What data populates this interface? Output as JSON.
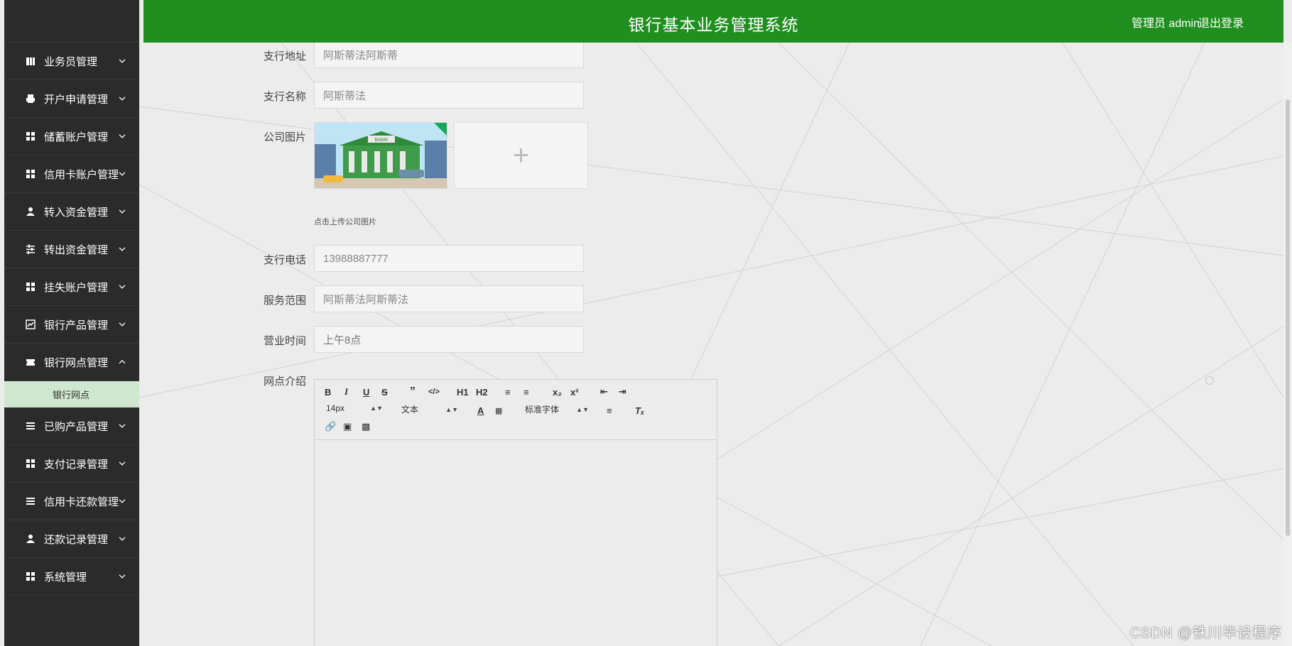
{
  "header": {
    "title": "银行基本业务管理系统",
    "user_text": "管理员 admin",
    "logout_label": "退出登录"
  },
  "sidebar": {
    "items": [
      {
        "label": "业务员管理",
        "icon": "book-icon"
      },
      {
        "label": "开户申请管理",
        "icon": "print-icon"
      },
      {
        "label": "储蓄账户管理",
        "icon": "grid-icon"
      },
      {
        "label": "信用卡账户管理",
        "icon": "grid-icon"
      },
      {
        "label": "转入资金管理",
        "icon": "user-icon"
      },
      {
        "label": "转出资金管理",
        "icon": "sliders-icon"
      },
      {
        "label": "挂失账户管理",
        "icon": "grid-icon"
      },
      {
        "label": "银行产品管理",
        "icon": "chart-icon"
      },
      {
        "label": "银行网点管理",
        "icon": "ticket-icon",
        "expanded": true,
        "sub": "银行网点"
      },
      {
        "label": "已购产品管理",
        "icon": "list-icon"
      },
      {
        "label": "支付记录管理",
        "icon": "grid-icon"
      },
      {
        "label": "信用卡还款管理",
        "icon": "list-icon"
      },
      {
        "label": "还款记录管理",
        "icon": "user-icon"
      },
      {
        "label": "系统管理",
        "icon": "grid-icon"
      }
    ]
  },
  "form": {
    "address_label": "支行地址",
    "address_value": "阿斯蒂法阿斯蒂",
    "name_label": "支行名称",
    "name_value": "阿斯蒂法",
    "image_label": "公司图片",
    "image_hint": "点击上传公司图片",
    "bank_sign": "BANK",
    "phone_label": "支行电话",
    "phone_value": "13988887777",
    "scope_label": "服务范围",
    "scope_value": "阿斯蒂法阿斯蒂法",
    "hours_label": "营业时间",
    "hours_value": "上午8点",
    "intro_label": "网点介绍"
  },
  "editor": {
    "font_size": "14px",
    "paragraph": "文本",
    "font_family": "标准字体",
    "h1": "H1",
    "h2": "H2"
  },
  "watermark": "CSDN @铁川毕设程序",
  "colors": {
    "header": "#208f20",
    "sidebar": "#2b2b2b",
    "active_sub": "#cfe7cf"
  }
}
